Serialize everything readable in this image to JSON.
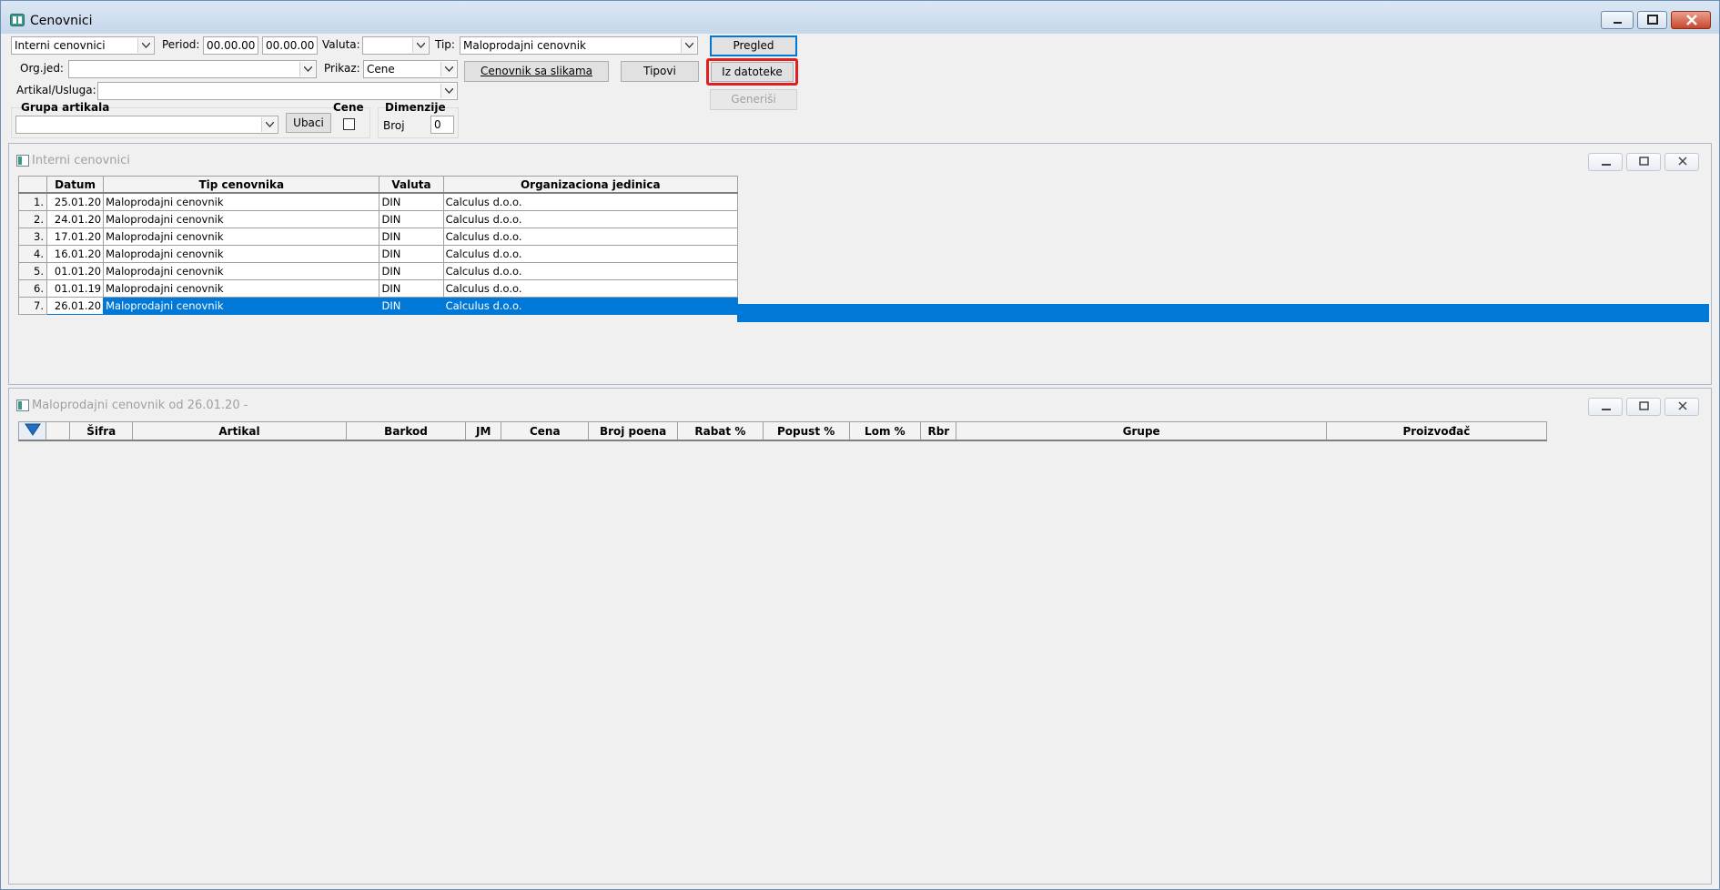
{
  "window": {
    "title": "Cenovnici"
  },
  "toolbar": {
    "source_select": "Interni cenovnici",
    "period_label": "Period:",
    "period_from": "00.00.00",
    "period_to": "00.00.00",
    "valuta_label": "Valuta:",
    "valuta_value": "",
    "tip_label": "Tip:",
    "tip_value": "Maloprodajni cenovnik",
    "pregled_button": "Pregled",
    "orgjed_label": "Org.jed:",
    "orgjed_value": "",
    "prikaz_label": "Prikaz:",
    "prikaz_value": "Cene",
    "cenovnik_slike_button": "Cenovnik sa slikama",
    "tipovi_button": "Tipovi",
    "iz_datoteke_button": "Iz datoteke",
    "artikal_label": "Artikal/Usluga:",
    "artikal_value": "",
    "generisi_button": "Generiši",
    "grupa_label": "Grupa artikala",
    "grupa_value": "",
    "ubaci_button": "Ubaci",
    "cene_label": "Cene",
    "dimenzije_label": "Dimenzije",
    "broj_label": "Broj",
    "broj_value": "0"
  },
  "panel1": {
    "title": "Interni cenovnici",
    "columns": [
      "Datum",
      "Tip cenovnika",
      "Valuta",
      "Organizaciona jedinica"
    ],
    "rows": [
      {
        "n": "1.",
        "datum": "25.01.20",
        "tip": "Maloprodajni cenovnik",
        "valuta": "DIN",
        "org": "Calculus d.o.o."
      },
      {
        "n": "2.",
        "datum": "24.01.20",
        "tip": "Maloprodajni cenovnik",
        "valuta": "DIN",
        "org": "Calculus d.o.o."
      },
      {
        "n": "3.",
        "datum": "17.01.20",
        "tip": "Maloprodajni cenovnik",
        "valuta": "DIN",
        "org": "Calculus d.o.o."
      },
      {
        "n": "4.",
        "datum": "16.01.20",
        "tip": "Maloprodajni cenovnik",
        "valuta": "DIN",
        "org": "Calculus d.o.o."
      },
      {
        "n": "5.",
        "datum": "01.01.20",
        "tip": "Maloprodajni cenovnik",
        "valuta": "DIN",
        "org": "Calculus d.o.o."
      },
      {
        "n": "6.",
        "datum": "01.01.19",
        "tip": "Maloprodajni cenovnik",
        "valuta": "DIN",
        "org": "Calculus d.o.o."
      },
      {
        "n": "7.",
        "datum": "26.01.20",
        "tip": "Maloprodajni cenovnik",
        "valuta": "DIN",
        "org": "Calculus d.o.o."
      }
    ]
  },
  "panel2": {
    "title": "Maloprodajni cenovnik od 26.01.20 -",
    "columns": [
      "Šifra",
      "Artikal",
      "Barkod",
      "JM",
      "Cena",
      "Broj poena",
      "Rabat %",
      "Popust %",
      "Lom %",
      "Rbr",
      "Grupe",
      "Proizvođač"
    ]
  },
  "colors": {
    "selection": "#0078d7",
    "highlight": "#e02020"
  }
}
